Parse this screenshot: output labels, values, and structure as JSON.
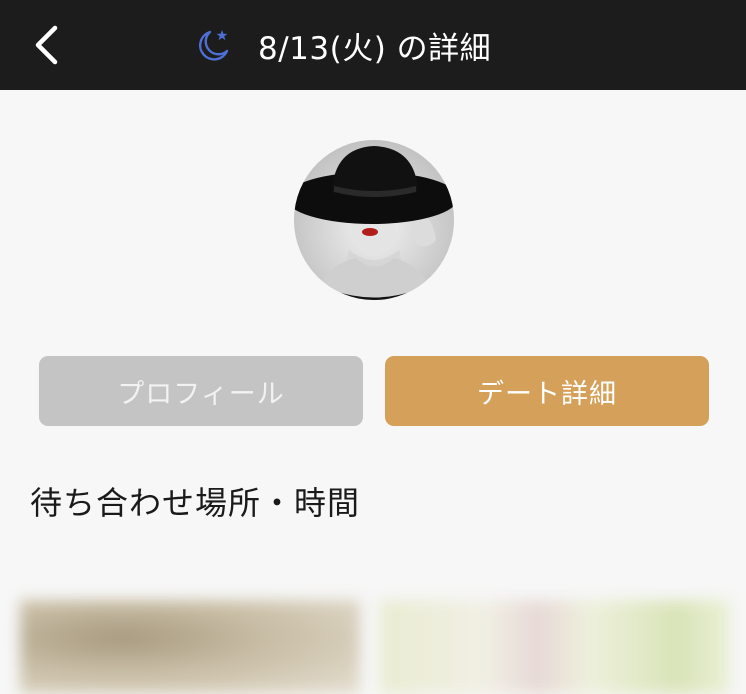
{
  "header": {
    "back_icon": "chevron-left-icon",
    "moon_icon": "moon-star-icon",
    "title": "8/13(火) の詳細",
    "colors": {
      "background": "#1c1c1c",
      "title": "#ffffff",
      "moon": "#4d6fd6"
    }
  },
  "profile": {
    "avatar_alt": "avatar"
  },
  "tabs": [
    {
      "label": "プロフィール",
      "state": "inactive",
      "color": "#c4c4c4"
    },
    {
      "label": "デート詳細",
      "state": "active",
      "color": "#d4a05a"
    }
  ],
  "section": {
    "title": "待ち合わせ場所・時間"
  }
}
